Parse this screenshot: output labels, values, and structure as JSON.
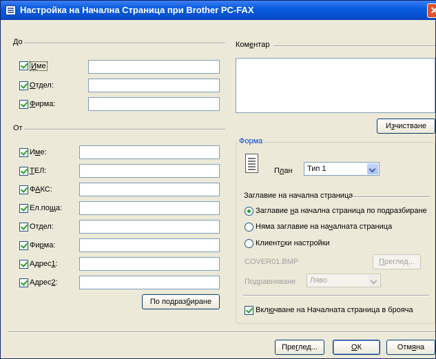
{
  "window": {
    "title": "Настройка на Начална Страница при Brother PC-FAX",
    "close_glyph": "✕"
  },
  "to_section": {
    "label": "До",
    "fields": [
      {
        "label_pre": "",
        "label_u": "И",
        "label_post": "ме",
        "value": ""
      },
      {
        "label_pre": "",
        "label_u": "О",
        "label_post": "тдел:",
        "value": ""
      },
      {
        "label_pre": "",
        "label_u": "Ф",
        "label_post": "ирма:",
        "value": ""
      }
    ]
  },
  "from_section": {
    "label": "От",
    "fields": [
      {
        "label_pre": "И",
        "label_u": "м",
        "label_post": "е:",
        "value": ""
      },
      {
        "label_pre": "",
        "label_u": "Т",
        "label_post": "ЕЛ:",
        "value": ""
      },
      {
        "label_pre": "Ф",
        "label_u": "А",
        "label_post": "КС:",
        "value": ""
      },
      {
        "label_pre": "Ел.по",
        "label_u": "щ",
        "label_post": "а:",
        "value": ""
      },
      {
        "label_pre": "Отдел:",
        "label_u": "",
        "label_post": "",
        "value": ""
      },
      {
        "label_pre": "Фи",
        "label_u": "р",
        "label_post": "ма:",
        "value": ""
      },
      {
        "label_pre": "Адрес",
        "label_u": "1",
        "label_post": ":",
        "value": ""
      },
      {
        "label_pre": "Адрес",
        "label_u": "2",
        "label_post": ":",
        "value": ""
      }
    ],
    "default_button": {
      "pre": "По подраз",
      "u": "б",
      "post": "иране"
    }
  },
  "comment": {
    "label_pre": "Ком",
    "label_u": "е",
    "label_post": "нтар",
    "value": "",
    "clear_button": {
      "pre": "И",
      "u": "з",
      "post": "чистване"
    }
  },
  "form_group": {
    "label": "Форма",
    "plan_label_pre": "П",
    "plan_label_u": "л",
    "plan_label_post": "ан",
    "plan_value": "Тип 1",
    "cover_title_label": "Заглавие на начална страница",
    "radios": [
      {
        "pre": "Заглавие ",
        "u": "н",
        "post": "а начална страница по подразбиране",
        "selected": true
      },
      {
        "pre": "Няма заглавие на на",
        "u": "ч",
        "post": "алната страница",
        "selected": false
      },
      {
        "pre": "Клиент",
        "u": "с",
        "post": "ки настройки",
        "selected": false
      }
    ],
    "file_name": "COVER01.BMP",
    "preview_small": {
      "pre": "",
      "u": "П",
      "post": "реглед..."
    },
    "align_label": "Подравняване",
    "align_value": "Ляво",
    "include_checkbox": {
      "pre": "Вкл",
      "u": "ю",
      "post": "чване на Началната страница в брояча",
      "checked": true
    }
  },
  "footer": {
    "preview": {
      "pre": "Пре",
      "u": "г",
      "post": "лед..."
    },
    "ok": {
      "pre": "",
      "u": "О",
      "post": "К"
    },
    "cancel": {
      "pre": "Отм",
      "u": "я",
      "post": "на"
    }
  }
}
